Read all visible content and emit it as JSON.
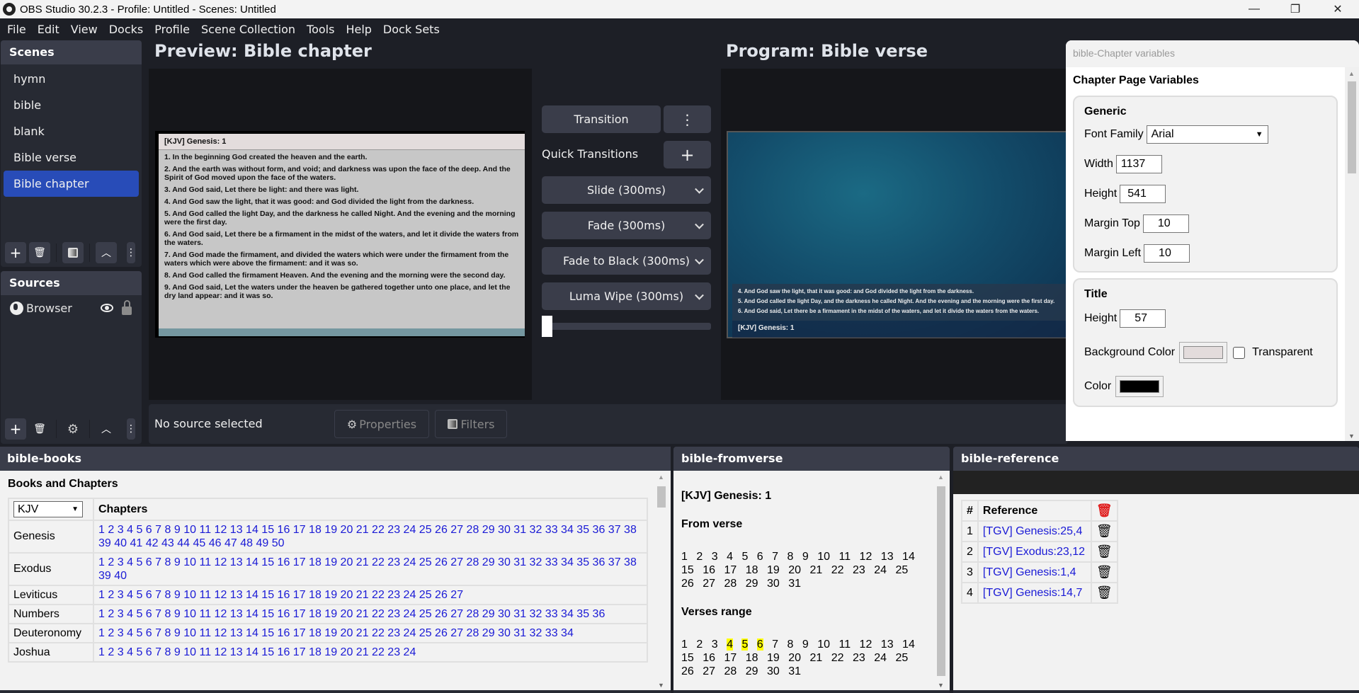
{
  "window": {
    "title": "OBS Studio 30.2.3 - Profile: Untitled - Scenes: Untitled",
    "controls": {
      "minimize": "—",
      "restore": "❐",
      "close": "✕"
    }
  },
  "menu": [
    "File",
    "Edit",
    "View",
    "Docks",
    "Profile",
    "Scene Collection",
    "Tools",
    "Help",
    "Dock Sets"
  ],
  "scenes": {
    "title": "Scenes",
    "items": [
      "hymn",
      "bible",
      "blank",
      "Bible verse",
      "Bible chapter"
    ],
    "selected": "Bible chapter"
  },
  "sources": {
    "title": "Sources",
    "items": [
      {
        "name": "Browser",
        "icon": "globe-icon",
        "visible": true,
        "locked": false
      }
    ]
  },
  "preview": {
    "title": "Preview: Bible chapter",
    "chapter_title": "[KJV] Genesis: 1",
    "verses": [
      "1. In the beginning God created the heaven and the earth.",
      "2. And the earth was without form, and void; and darkness was upon the face of the deep. And the Spirit of God moved upon the face of the waters.",
      "3. And God said, Let there be light: and there was light.",
      "4. And God saw the light, that it was good: and God divided the light from the darkness.",
      "5. And God called the light Day, and the darkness he called Night. And the evening and the morning were the first day.",
      "6. And God said, Let there be a firmament in the midst of the waters, and let it divide the waters from the waters.",
      "7. And God made the firmament, and divided the waters which were under the firmament from the waters which were above the firmament: and it was so.",
      "8. And God called the firmament Heaven. And the evening and the morning were the second day.",
      "9. And God said, Let the waters under the heaven be gathered together unto one place, and let the dry land appear: and it was so."
    ]
  },
  "program": {
    "title": "Program: Bible verse",
    "verses": [
      "4. And God saw the light, that it was good: and God divided the light from the darkness.",
      "5. And God called the light Day, and the darkness he called Night. And the evening and the morning were the first day.",
      "6. And God said, Let there be a firmament in the midst of the waters, and let it divide the waters from the waters."
    ],
    "reference": "[KJV] Genesis: 1"
  },
  "transitions": {
    "transition_label": "Transition",
    "quick_label": "Quick Transitions",
    "quick": [
      "Slide (300ms)",
      "Fade (300ms)",
      "Fade to Black (300ms)",
      "Luma Wipe (300ms)"
    ],
    "tbar_value": 0
  },
  "source_bar": {
    "status": "No source selected",
    "properties": "Properties",
    "filters": "Filters"
  },
  "variables": {
    "dock_title": "bible-Chapter variables",
    "heading": "Chapter Page Variables",
    "generic": {
      "title": "Generic",
      "font_family_label": "Font Family",
      "font_family": "Arial",
      "width_label": "Width",
      "width": "1137",
      "height_label": "Height",
      "height": "541",
      "margin_top_label": "Margin Top",
      "margin_top": "10",
      "margin_left_label": "Margin Left",
      "margin_left": "10"
    },
    "title_section": {
      "title": "Title",
      "height_label": "Height",
      "height": "57",
      "bg_color_label": "Background Color",
      "bg_color": "#e3dcdc",
      "transparent_label": "Transparent",
      "transparent": false,
      "color_label": "Color",
      "color": "#000000"
    }
  },
  "books": {
    "dock_title": "bible-books",
    "heading": "Books and Chapters",
    "version": "KJV",
    "chapters_header": "Chapters",
    "rows": [
      {
        "book": "Genesis",
        "chapters": 50
      },
      {
        "book": "Exodus",
        "chapters": 40
      },
      {
        "book": "Leviticus",
        "chapters": 27
      },
      {
        "book": "Numbers",
        "chapters": 36
      },
      {
        "book": "Deuteronomy",
        "chapters": 34
      },
      {
        "book": "Joshua",
        "chapters": 24
      }
    ]
  },
  "fromverse": {
    "dock_title": "bible-fromverse",
    "reference": "[KJV] Genesis: 1",
    "from_label": "From verse",
    "range_label": "Verses range",
    "verse_count": 31,
    "highlighted": [
      4,
      5,
      6
    ]
  },
  "reference": {
    "dock_title": "bible-reference",
    "col_num": "#",
    "col_ref": "Reference",
    "rows": [
      {
        "n": "1",
        "ref": "[TGV] Genesis:25,4"
      },
      {
        "n": "2",
        "ref": "[TGV] Exodus:23,12"
      },
      {
        "n": "3",
        "ref": "[TGV] Genesis:1,4"
      },
      {
        "n": "4",
        "ref": "[TGV] Genesis:14,7"
      }
    ],
    "delete_all_color": "#e02020"
  }
}
